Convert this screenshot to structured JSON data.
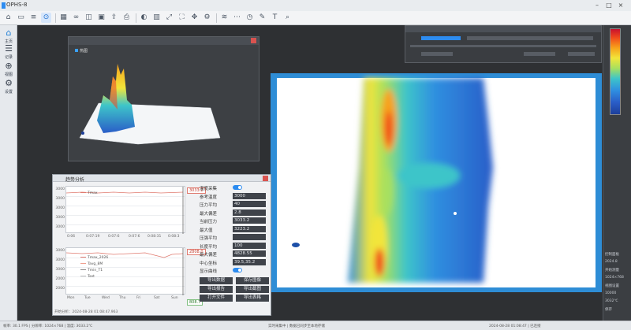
{
  "app": {
    "title": "OPHS-8"
  },
  "toolbar": {
    "tools": [
      "home-icon",
      "folder-icon",
      "layers-icon",
      "target-icon",
      "grid-icon",
      "link-icon",
      "split-icon",
      "save-icon",
      "export-icon",
      "print-icon",
      "palette-icon",
      "chart-icon",
      "expand-icon",
      "fullscreen-icon",
      "arrows-icon",
      "gear-icon",
      "wifi-icon",
      "more-icon",
      "clock-icon",
      "pen-icon",
      "text-icon",
      "zoom-icon"
    ]
  },
  "leftnav": {
    "items": [
      {
        "label": "主页",
        "icon": "home-icon"
      },
      {
        "label": "记录",
        "icon": "database-icon"
      },
      {
        "label": "视图",
        "icon": "crosshair-icon"
      },
      {
        "label": "设置",
        "icon": "settings-icon"
      }
    ]
  },
  "win3d": {
    "legend": "热图"
  },
  "trend": {
    "title": "趋势分析",
    "plot1": {
      "value_tag": "3033.2",
      "legend": [
        "Tmax"
      ],
      "ytick": [
        "3000",
        "3000",
        "3000",
        "3000",
        "3000"
      ],
      "xtick": [
        "0:06",
        "0:07:19",
        "0:07:6",
        "0:07:6",
        "0:08:31",
        "0:08:3"
      ]
    },
    "plot2": {
      "value_tag": "2808.0",
      "value_tag2": "808.7",
      "legend": [
        "Tmax_2026",
        "Tavg_8M",
        "Tmin_T1",
        "Tset"
      ],
      "ytick": [
        "3000",
        "3000",
        "3000",
        "2000",
        "2000"
      ],
      "xtick": [
        "Mon",
        "Tue",
        "Wed",
        "Thu",
        "Fri",
        "Sat",
        "Sun"
      ]
    },
    "params": [
      {
        "key": "温度采集",
        "value": ""
      },
      {
        "key": "参考温度",
        "value": "3000"
      },
      {
        "key": "压力平均",
        "value": "40"
      },
      {
        "key": "最大偏差",
        "value": "2.8"
      },
      {
        "key": "当前压力",
        "value": "3033.2"
      },
      {
        "key": "最大值",
        "value": "3223.2"
      },
      {
        "key": "压强平均",
        "value": ""
      },
      {
        "key": "长度平均",
        "value": "100"
      },
      {
        "key": "最大偏差",
        "value": "4828.55"
      },
      {
        "key": "中心坐标",
        "value": "39.5,35.2"
      },
      {
        "key": "显示曲线",
        "value": ""
      }
    ],
    "buttons": [
      "导出数据",
      "保存图像",
      "导出报告",
      "导出截图",
      "打开文件",
      "导出表格"
    ],
    "status": "开始分析：2024-08-28 01:08:47.963"
  },
  "rightpanel": {
    "items": [
      "控制面板",
      "2024.8",
      "开始测量",
      "1024×768",
      "视图设置",
      "10000",
      "3032℃",
      "保存"
    ]
  },
  "statusbar": {
    "left": "帧率: 30.1 FPS  |  分辨率: 1024×768  |  温度: 3033.2℃",
    "mid": "实时采集中  |  数据已同步至本地存储",
    "right": "2024-08-28 01:08:47  |  已连接"
  }
}
